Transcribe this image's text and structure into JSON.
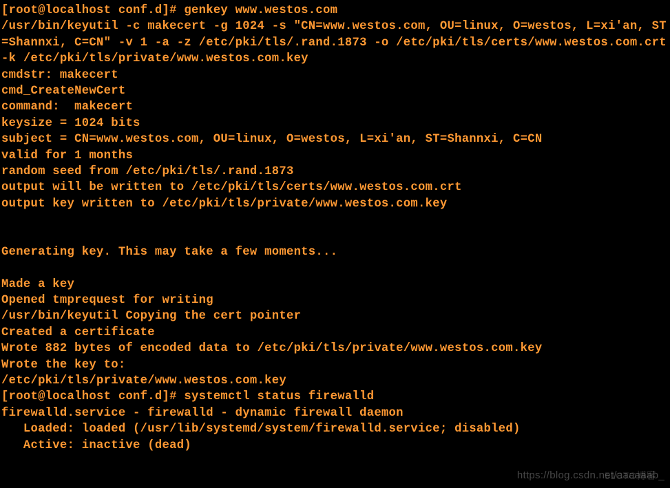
{
  "prompt1": "[root@localhost conf.d]# ",
  "cmd1": "genkey www.westos.com",
  "output": {
    "l1": "/usr/bin/keyutil -c makecert -g 1024 -s \"CN=www.westos.com, OU=linux, O=westos, L=xi'an, ST=Shannxi, C=CN\" -v 1 -a -z /etc/pki/tls/.rand.1873 -o /etc/pki/tls/certs/www.westos.com.crt -k /etc/pki/tls/private/www.westos.com.key",
    "l2": "cmdstr: makecert",
    "l3": "",
    "l4": "cmd_CreateNewCert",
    "l5": "command:  makecert",
    "l6": "keysize = 1024 bits",
    "l7": "subject = CN=www.westos.com, OU=linux, O=westos, L=xi'an, ST=Shannxi, C=CN",
    "l8": "valid for 1 months",
    "l9": "random seed from /etc/pki/tls/.rand.1873",
    "l10": "output will be written to /etc/pki/tls/certs/www.westos.com.crt",
    "l11": "output key written to /etc/pki/tls/private/www.westos.com.key",
    "l12": "",
    "l13": "",
    "l14": "Generating key. This may take a few moments...",
    "l15": "",
    "l16": "Made a key",
    "l17": "Opened tmprequest for writing",
    "l18": "/usr/bin/keyutil Copying the cert pointer",
    "l19": "Created a certificate",
    "l20": "Wrote 882 bytes of encoded data to /etc/pki/tls/private/www.westos.com.key",
    "l21": "Wrote the key to:",
    "l22": "/etc/pki/tls/private/www.westos.com.key"
  },
  "prompt2": "[root@localhost conf.d]# ",
  "cmd2": "systemctl status firewalld",
  "output2": {
    "l1": "firewalld.service - firewalld - dynamic firewall daemon",
    "l2": "   Loaded: loaded (/usr/lib/systemd/system/firewalld.service; disabled)",
    "l3": "   Active: inactive (dead)"
  },
  "watermark": "https://blog.csdn.net/aaaaaab_",
  "watermark2": "51CTO博客"
}
